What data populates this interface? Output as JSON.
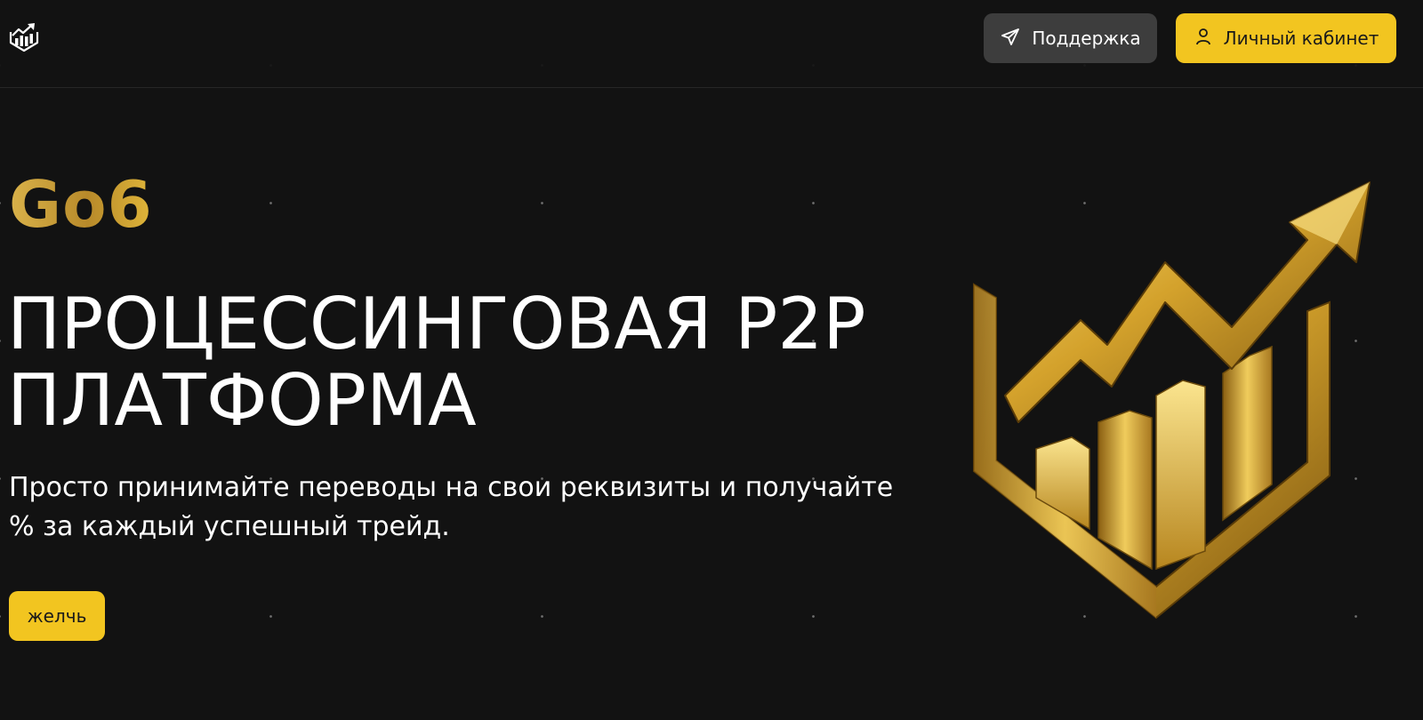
{
  "header": {
    "logo_icon": "chart-shield-logo-icon",
    "support_button": {
      "label": "Поддержка",
      "icon": "telegram-send-icon"
    },
    "cabinet_button": {
      "label": "Личный кабинет",
      "icon": "user-icon"
    }
  },
  "hero": {
    "brand": "Go6",
    "headline_line1": "ПРОЦЕССИНГОВАЯ P2P",
    "headline_line2": "ПЛАТФОРМА",
    "subtitle": "Просто принимайте переводы на свои реквизиты и получайте % за каждый успешный трейд.",
    "cta_label": "желчь",
    "illustration_icon": "gold-chart-shield-icon"
  },
  "colors": {
    "background": "#121212",
    "accent_yellow": "#f2c520",
    "support_button_bg": "#3d3d3d",
    "gold": "#d4a62e"
  }
}
